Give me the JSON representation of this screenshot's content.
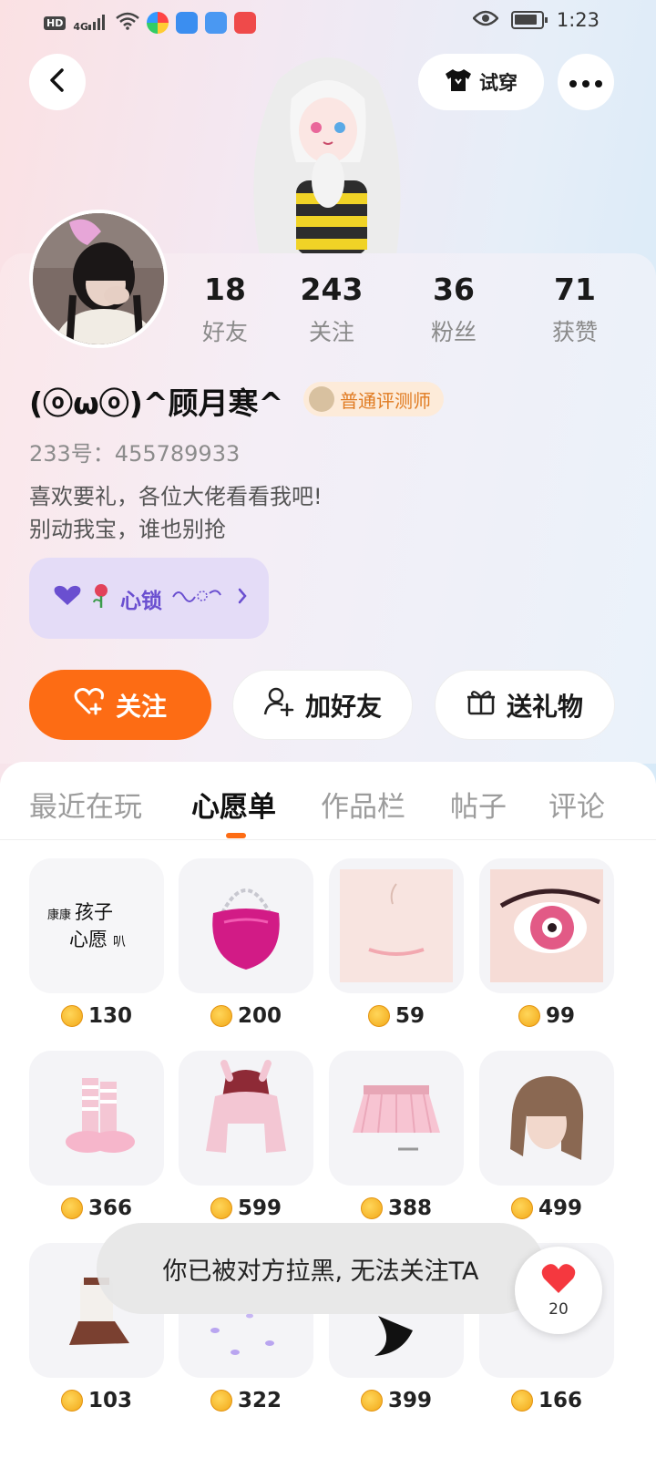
{
  "status_bar": {
    "hd": "HD",
    "signal": "4G",
    "time": "1:23"
  },
  "header": {
    "try_on_label": "试穿",
    "back_icon": "chevron-left-icon",
    "more_icon": "more-dots-icon"
  },
  "stats": [
    {
      "value": "18",
      "label": "好友"
    },
    {
      "value": "243",
      "label": "关注"
    },
    {
      "value": "36",
      "label": "粉丝"
    },
    {
      "value": "71",
      "label": "获赞"
    }
  ],
  "profile": {
    "nickname": "(ⓞωⓞ)^顾月寒^",
    "role_badge": "普通评测师",
    "uid": "233号：455789933",
    "bio_line1": "喜欢要礼，各位大佬看看我吧!",
    "bio_line2": "别动我宝，谁也别抢",
    "heart_lock_label": "心锁"
  },
  "actions": {
    "follow": "关注",
    "add_friend": "加好友",
    "send_gift": "送礼物"
  },
  "tabs": [
    "最近在玩",
    "心愿单",
    "作品栏",
    "帖子",
    "评论"
  ],
  "active_tab": "心愿单",
  "wishlist": [
    {
      "name": "康康孩子心愿叭",
      "price": "130"
    },
    {
      "name": "handbag",
      "price": "200"
    },
    {
      "name": "face",
      "price": "59"
    },
    {
      "name": "eye",
      "price": "99"
    },
    {
      "name": "socks-shoes",
      "price": "366"
    },
    {
      "name": "bunny-hoodie",
      "price": "599"
    },
    {
      "name": "pink-skirt",
      "price": "388"
    },
    {
      "name": "brown-hair",
      "price": "499"
    },
    {
      "name": "boots",
      "price": "103"
    },
    {
      "name": "petals",
      "price": "322"
    },
    {
      "name": "tail",
      "price": "399"
    },
    {
      "name": "item",
      "price": "166"
    }
  ],
  "wish_card_text": {
    "line1": "康康",
    "line2": "孩子",
    "line3": "心愿",
    "line4": "叭"
  },
  "toast": "你已被对方拉黑, 无法关注TA",
  "like_count": "20",
  "colors": {
    "accent": "#fd6c14",
    "badge": "#e07a20",
    "lock": "#6a4fd0"
  }
}
